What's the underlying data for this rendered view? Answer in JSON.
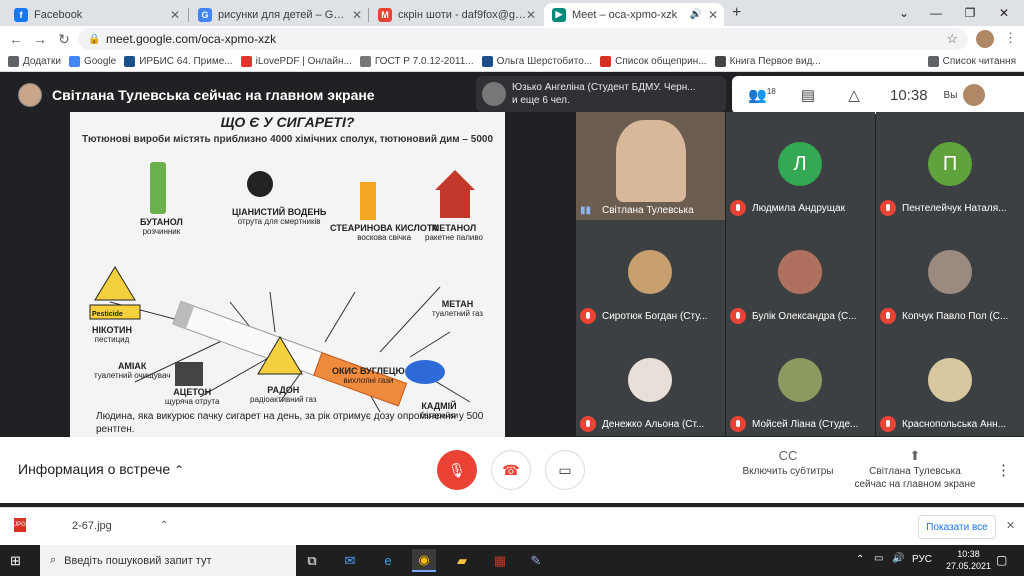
{
  "tabs": [
    {
      "label": "Facebook",
      "color": "#1877f2",
      "glyph": "f"
    },
    {
      "label": "рисунки для детей – Google Пои",
      "color": "#4285f4",
      "glyph": "G"
    },
    {
      "label": "скрін шоти - daf9fox@gmail.com",
      "color": "#ea4335",
      "glyph": "M"
    },
    {
      "label": "Meet – oca-xpmo-xzk",
      "color": "#00897b",
      "glyph": "▶"
    }
  ],
  "address": "meet.google.com/oca-xpmo-xzk",
  "bookmarks": [
    {
      "label": "Додатки",
      "color": "#5f6368"
    },
    {
      "label": "Google",
      "color": "#4285f4"
    },
    {
      "label": "ИРБИС 64. Приме...",
      "color": "#1a4f8b"
    },
    {
      "label": "iLovePDF | Онлайн...",
      "color": "#e5322d"
    },
    {
      "label": "ГОСТ Р 7.0.12-2011...",
      "color": "#777"
    },
    {
      "label": "Ольга Шерстобито...",
      "color": "#1a4f8b"
    },
    {
      "label": "Список общеприн...",
      "color": "#d93025"
    },
    {
      "label": "Книга Первое вид...",
      "color": "#444"
    }
  ],
  "reading_list": "Список читання",
  "meet": {
    "presenter_banner": "Світлана Тулевська сейчас на главном экране",
    "notification_line1": "Юзько Ангеліна (Студент БДМУ. Черн...",
    "notification_line2": "и еще 6 чел.",
    "people_count": "18",
    "clock": "10:38",
    "you_label": "Вы"
  },
  "slide": {
    "heading": "ЩО Є У СИГАРЕТІ?",
    "subheading": "Тютюнові вироби містять приблизно 4000 хімічних сполук, тютюновий дим – 5000",
    "labels": [
      {
        "title": "БУТАНОЛ",
        "desc": "розчинник"
      },
      {
        "title": "ЦІАНИСТИЙ ВОДЕНЬ",
        "desc": "отрута для смертників"
      },
      {
        "title": "СТЕАРИНОВА КИСЛОТА",
        "desc": "воскова свічка"
      },
      {
        "title": "МЕТАНОЛ",
        "desc": "ракетне паливо"
      },
      {
        "title": "НІКОТИН",
        "desc": "пестицид"
      },
      {
        "title": "МЕТАН",
        "desc": "туалетний газ"
      },
      {
        "title": "АМІАК",
        "desc": "туалетний очищувач"
      },
      {
        "title": "АЦЕТОН",
        "desc": "щуряча отрута"
      },
      {
        "title": "РАДОН",
        "desc": "радіоактивний газ"
      },
      {
        "title": "ОКИС ВУГЛЕЦЮ",
        "desc": "вихлопні гази"
      },
      {
        "title": "КАДМІЙ",
        "desc": "батарейки"
      }
    ],
    "pesticide": "Pesticide",
    "footer": "Людина, яка викурює пачку сигарет на день, за рік отримує дозу опромінення у 500 рентген."
  },
  "participants": [
    {
      "name": "Світлана Тулевська",
      "initial": "",
      "color": "#8b7a66",
      "video": true
    },
    {
      "name": "Людмила Андрущак",
      "initial": "Л",
      "color": "#34a853"
    },
    {
      "name": "Пентелейчук Наталя...",
      "initial": "П",
      "color": "#5fa33a"
    },
    {
      "name": "Сиротюк Богдан (Сту...",
      "initial": "",
      "color": "#c8a070"
    },
    {
      "name": "Булік Олександра (С...",
      "initial": "",
      "color": "#b07060"
    },
    {
      "name": "Копчук Павло Пол (С...",
      "initial": "",
      "color": "#9a8a80"
    },
    {
      "name": "Денежко Альона (Ст...",
      "initial": "",
      "color": "#e8e0d8"
    },
    {
      "name": "Мойсей Ліана (Студе...",
      "initial": "",
      "color": "#8a9a60"
    },
    {
      "name": "Краснопольська Анн...",
      "initial": "",
      "color": "#d8c8a0"
    }
  ],
  "bottom": {
    "info": "Информация о встрече",
    "subtitles": "Включить субтитры",
    "presenting_line1": "Світлана Тулевська",
    "presenting_line2": "сейчас на главном экране"
  },
  "download": {
    "file": "2-67.jpg",
    "show_all": "Показати все"
  },
  "taskbar": {
    "search_placeholder": "Введіть пошуковий запит тут",
    "lang": "РУС",
    "time": "10:38",
    "date": "27.05.2021"
  }
}
